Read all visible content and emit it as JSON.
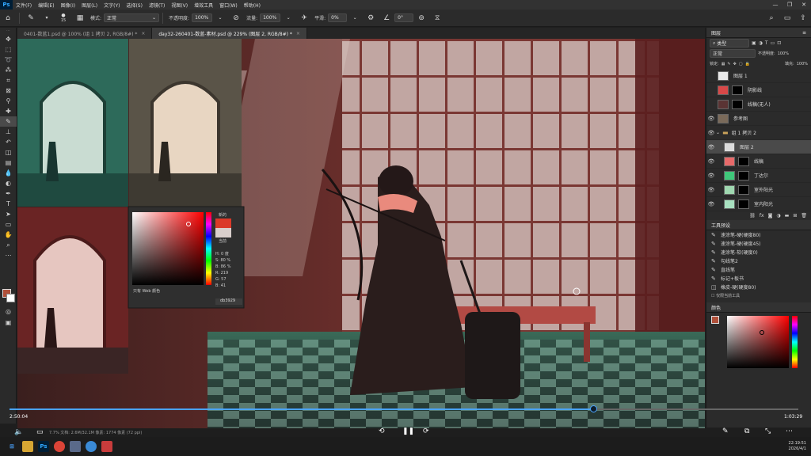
{
  "menubar": {
    "logo": "Ps",
    "items": [
      "文件(F)",
      "编辑(E)",
      "图像(I)",
      "图层(L)",
      "文字(Y)",
      "选择(S)",
      "滤镜(T)",
      "视图(V)",
      "增效工具",
      "窗口(W)",
      "帮助(H)"
    ]
  },
  "optbar": {
    "brush_size": "15",
    "mode_label": "模式:",
    "mode_value": "正常",
    "opacity_label": "不透明度:",
    "opacity_value": "100%",
    "flow_label": "流量:",
    "flow_value": "100%",
    "smooth_label": "平滑:",
    "smooth_value": "0%",
    "angle_value": "0°"
  },
  "tabs": [
    {
      "label": "0401-数蓝1.psd @ 100% (组 1 拷贝 2, RGB/8#) *"
    },
    {
      "label": "day32-260401-数蓝-素材.psd @ 229% (图层 2, RGB/8#) *"
    }
  ],
  "color_picker": {
    "new_label": "新的",
    "current_label": "当前",
    "h_label": "H:",
    "h_value": "0",
    "h_unit": "度",
    "s_label": "S:",
    "s_value": "80",
    "s_unit": "%",
    "b_label": "B:",
    "b_value": "86",
    "b_unit": "%",
    "r_label": "R:",
    "r_value": "219",
    "g_label": "G:",
    "g_value": "57",
    "bl_label": "B:",
    "bl_value": "41",
    "web_only": "只有 Web 颜色",
    "hex_value": "db3929",
    "colors": {
      "hue_base": "#ff0000",
      "new": "#db3929",
      "current": "#d9cfcc"
    }
  },
  "layers_panel": {
    "title": "图层",
    "kind_label": "类型",
    "blend_mode": "正常",
    "opacity_label": "不透明度:",
    "opacity_value": "100%",
    "lock_label": "锁定:",
    "fill_label": "填充:",
    "fill_value": "100%",
    "layers": [
      {
        "name": "图层 1",
        "thumb": "#e8e8e8",
        "mask": false,
        "visible": false
      },
      {
        "name": "阴影线",
        "thumb": "#d84848",
        "mask": true,
        "visible": false
      },
      {
        "name": "线稿(无人)",
        "thumb": "#5a3434",
        "mask": true,
        "visible": false
      },
      {
        "name": "参考图",
        "thumb": "#7a6a5a",
        "mask": false,
        "visible": true
      },
      {
        "name": "组 1 拷贝 2",
        "thumb": "",
        "mask": false,
        "visible": true
      },
      {
        "name": "图层 2",
        "thumb": "#dcdcdc",
        "mask": false,
        "visible": true
      },
      {
        "name": "线稿",
        "thumb": "#e86a6a",
        "mask": true,
        "visible": true
      },
      {
        "name": "丁达尔",
        "thumb": "#3fc87a",
        "mask": true,
        "visible": true
      },
      {
        "name": "室外阳光",
        "thumb": "#9fd8b0",
        "mask": true,
        "visible": true
      },
      {
        "name": "室内阳光",
        "thumb": "#a8e0c0",
        "mask": true,
        "visible": true
      }
    ]
  },
  "tool_presets": {
    "title": "工具预设",
    "items": [
      "速涂笔-硬(硬度80)",
      "速涂笔-硬(硬度45)",
      "速涂笔-软(硬度0)",
      "勾线笔2",
      "直线笔",
      "标记+板书",
      "橡皮-硬(硬度80)"
    ],
    "current_tool_only": "仅限当前工具"
  },
  "color_panel": {
    "title": "颜色"
  },
  "video": {
    "elapsed": "2:50:04",
    "total": "1:03:29",
    "progress": 0.74,
    "status_text": "7.7% 文档: 2.6M/32.1M  像素: 1774 像素 (72 ppi)"
  },
  "taskbar": {
    "time": "22:19:51",
    "date": "2026/4/1"
  }
}
